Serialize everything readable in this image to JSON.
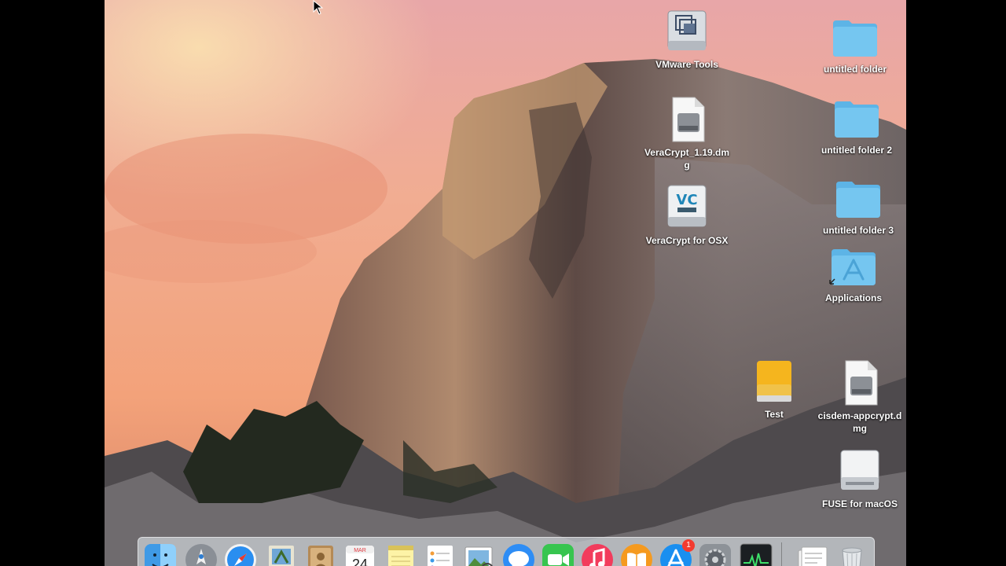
{
  "desktop": {
    "icons": [
      {
        "label": "VMware Tools",
        "icon": "vmware-tools-disk-icon"
      },
      {
        "label": "untitled folder",
        "icon": "folder-icon"
      },
      {
        "label": "VeraCrypt_1.19.dmg",
        "icon": "dmg-file-icon"
      },
      {
        "label": "untitled folder 2",
        "icon": "folder-icon"
      },
      {
        "label": "VeraCrypt for OSX",
        "icon": "veracrypt-disk-icon"
      },
      {
        "label": "untitled folder 3",
        "icon": "folder-icon"
      },
      {
        "label": "Applications",
        "icon": "applications-folder-alias-icon"
      },
      {
        "label": "Test",
        "icon": "external-drive-icon"
      },
      {
        "label": "cisdem-appcrypt.dmg",
        "icon": "dmg-file-icon"
      },
      {
        "label": "FUSE for macOS",
        "icon": "mounted-disk-icon"
      }
    ]
  },
  "dock": {
    "apps": [
      {
        "name": "Finder",
        "icon": "finder-icon"
      },
      {
        "name": "Launchpad",
        "icon": "launchpad-icon"
      },
      {
        "name": "Safari",
        "icon": "safari-icon"
      },
      {
        "name": "Mail",
        "icon": "mail-icon"
      },
      {
        "name": "Contacts",
        "icon": "contacts-icon"
      },
      {
        "name": "Calendar",
        "icon": "calendar-icon",
        "month": "MAR",
        "day": "24"
      },
      {
        "name": "Notes",
        "icon": "notes-icon"
      },
      {
        "name": "Reminders",
        "icon": "reminders-icon"
      },
      {
        "name": "Preview",
        "icon": "preview-icon"
      },
      {
        "name": "Messages",
        "icon": "messages-icon"
      },
      {
        "name": "FaceTime",
        "icon": "facetime-icon"
      },
      {
        "name": "iTunes",
        "icon": "itunes-icon"
      },
      {
        "name": "iBooks",
        "icon": "ibooks-icon"
      },
      {
        "name": "App Store",
        "icon": "app-store-icon",
        "badge": "1"
      },
      {
        "name": "System Preferences",
        "icon": "system-preferences-icon"
      },
      {
        "name": "Activity Monitor",
        "icon": "activity-monitor-icon"
      },
      {
        "name": "Documents",
        "icon": "documents-stack-icon"
      },
      {
        "name": "Trash",
        "icon": "trash-icon"
      }
    ]
  },
  "colors": {
    "folder_blue": "#6cc3ef",
    "dock_background": "#cdd2d8",
    "badge_red": "#f33b30"
  }
}
